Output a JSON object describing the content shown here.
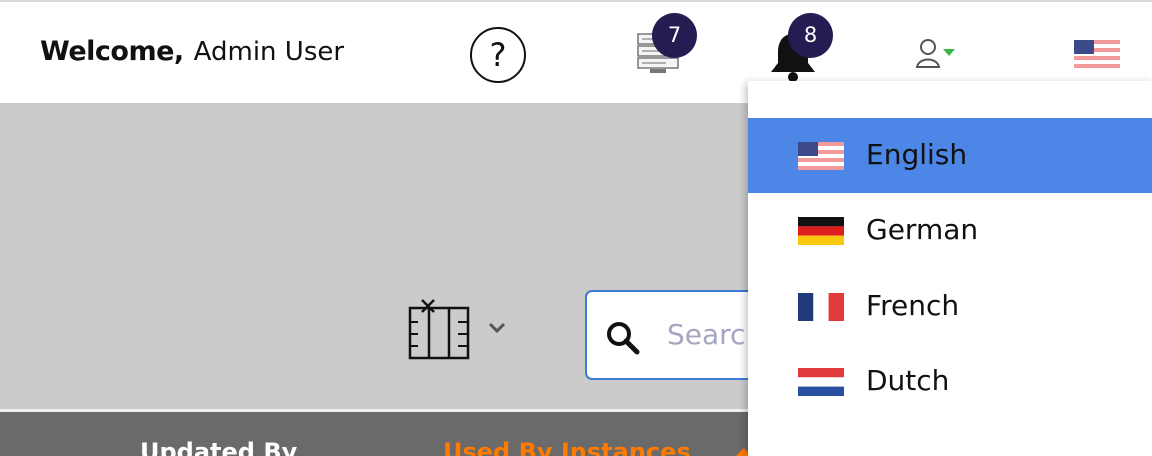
{
  "header": {
    "welcome_label": "Welcome,",
    "user_name": "Admin User",
    "help_symbol": "?",
    "messages_badge": "7",
    "notifications_badge": "8"
  },
  "toolbar": {
    "search_placeholder": "Search"
  },
  "table": {
    "headers": [
      "Updated By",
      "Used By Instances"
    ]
  },
  "language_menu": {
    "options": [
      {
        "label": "English",
        "flag": "us-flag",
        "selected": true
      },
      {
        "label": "German",
        "flag": "de-flag",
        "selected": false
      },
      {
        "label": "French",
        "flag": "fr-flag",
        "selected": false
      },
      {
        "label": "Dutch",
        "flag": "nl-flag",
        "selected": false
      }
    ]
  },
  "colors": {
    "badge_bg": "#231d52",
    "selected_bg": "#4c86e6",
    "search_border": "#3d7bd9",
    "table_header_bg": "#6a6a6a",
    "sorted_column_text": "#ff7a00"
  }
}
